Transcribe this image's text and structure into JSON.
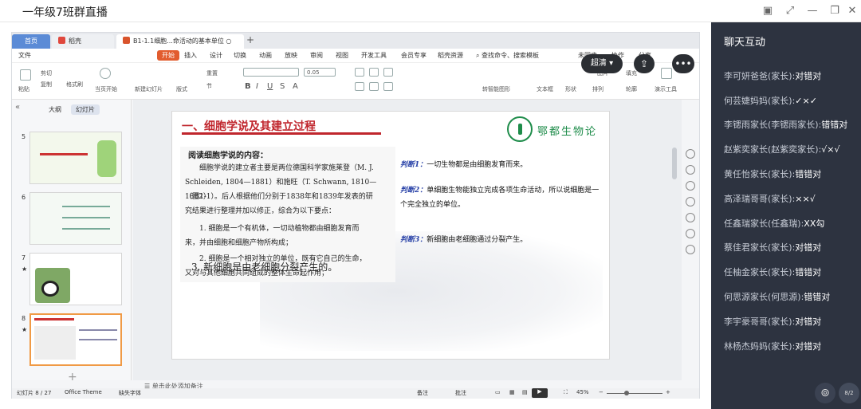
{
  "window": {
    "title": "一年级7班群直播"
  },
  "live_controls": {
    "quality": "超清"
  },
  "ppt": {
    "tabs": {
      "home": "首页",
      "doc": "稻壳",
      "active": "B1-1.1细胞...命活动的基本单位"
    },
    "menu": [
      "文件",
      "开始",
      "插入",
      "设计",
      "切换",
      "动画",
      "放映",
      "审阅",
      "视图",
      "开发工具",
      "会员专享",
      "稻壳资源"
    ],
    "search": "查找命令、搜索模板",
    "menu_right": [
      "未同步",
      "协作",
      "分享"
    ],
    "ribbon": {
      "paste": "粘贴",
      "cut": "剪切",
      "copy": "复制",
      "format": "格式刷",
      "from_current": "当页开始",
      "new_slide": "新建幻灯片",
      "layout": "版式",
      "reset": "重置",
      "section": "节",
      "font_size": "0.05",
      "textbox": "文本框",
      "shape": "形状",
      "arrange": "排列",
      "image": "图片",
      "fill": "填充",
      "outline": "轮廓",
      "present": "演示工具",
      "convert": "转智能图形"
    },
    "pane_tabs": [
      "大纲",
      "幻灯片"
    ],
    "slide_numbers": [
      "5",
      "6",
      "7",
      "8"
    ],
    "slide": {
      "title": "一、细胞学说及其建立过程",
      "logo": "鄂都生物论",
      "heading": "阅读细胞学说的内容：",
      "para": [
        "细胞学说的建立者主要是两位德国科学家施莱登（M. J.",
        "Schleiden, 1804—1881）和施旺（T. Schwann, 1810—1882）",
        "（图1-1）。后人根据他们分别于1838年和1839年发表的研",
        "究结果进行整理并加以修正，综合为以下要点：",
        "1. 细胞是一个有机体，一切动植物都由细胞发育而",
        "来，并由细胞和细胞产物所构成；",
        "2. 细胞是一个相对独立的单位，既有它自己的生命，",
        "又对与其他细胞共同组成的整体生命起作用；"
      ],
      "point3": "3. 新细胞是由老细胞分裂产生的。",
      "judgments": [
        {
          "label": "判断1：",
          "text": "一切生物都是由细胞发育而来。"
        },
        {
          "label": "判断2：",
          "text": "单细胞生物能独立完成各项生命活动，所以说细胞是一个完全独立的单位。"
        },
        {
          "label": "判断3：",
          "text": "新细胞由老细胞通过分裂产生。"
        }
      ]
    },
    "notes": "单击此处添加备注",
    "status": {
      "slide": "幻灯片 8 / 27",
      "theme": "Office Theme",
      "font": "缺失字体",
      "notes": "备注",
      "comment": "批注",
      "zoom": "45%"
    }
  },
  "chat": {
    "title": "聊天互动",
    "messages": [
      {
        "name": "李可妍爸爸(家长):",
        "text": "对错对"
      },
      {
        "name": "何芸婕妈妈(家长):",
        "text": "✓×✓"
      },
      {
        "name": "李锶雨家长(李锶雨家长):",
        "text": "错错对"
      },
      {
        "name": "赵紫奕家长(赵紫奕家长):",
        "text": "√×√"
      },
      {
        "name": "黄任怡家长(家长):",
        "text": "错错对"
      },
      {
        "name": "高泽瑞哥哥(家长):",
        "text": "××√"
      },
      {
        "name": "任鑫瑞家长(任鑫瑞):",
        "text": "XX勾"
      },
      {
        "name": "蔡佳君家长(家长):",
        "text": "对错对"
      },
      {
        "name": "任柚金家长(家长):",
        "text": "错错对"
      },
      {
        "name": "何思源家长(何思源):",
        "text": "错错对"
      },
      {
        "name": "李宇豪哥哥(家长):",
        "text": "对错对"
      },
      {
        "name": "林杨杰妈妈(家长):",
        "text": "对错对"
      }
    ],
    "badge": "8/2"
  }
}
